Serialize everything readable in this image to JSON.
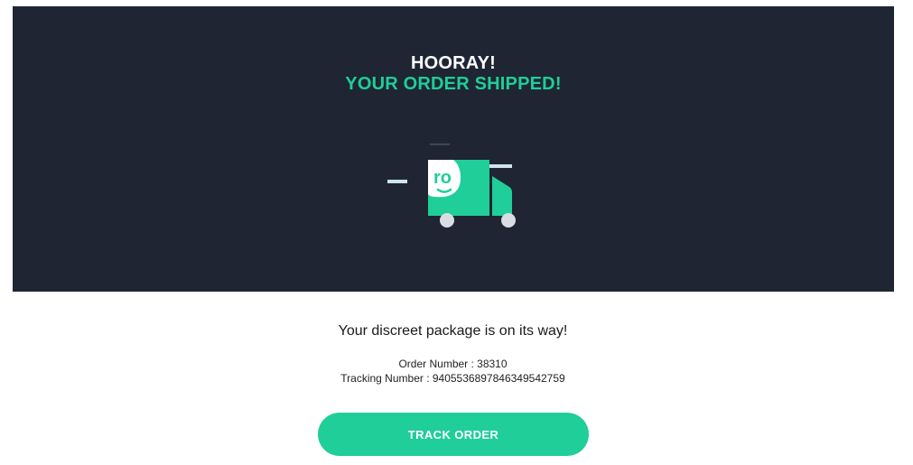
{
  "hero": {
    "line1": "HOORAY!",
    "line2": "YOUR ORDER SHIPPED!",
    "logo_text": "ro",
    "illustration": "delivery-truck-icon"
  },
  "message": "Your discreet package is on its way!",
  "order": {
    "order_number_line": "Order Number : 38310",
    "tracking_number_line": "Tracking Number : 9405536897846349542759"
  },
  "track_button_label": "TRACK ORDER",
  "colors": {
    "hero_bg": "#1f2533",
    "accent": "#1fce98",
    "wheel": "#d9dde3",
    "speed_line": "#cfe3ee"
  }
}
